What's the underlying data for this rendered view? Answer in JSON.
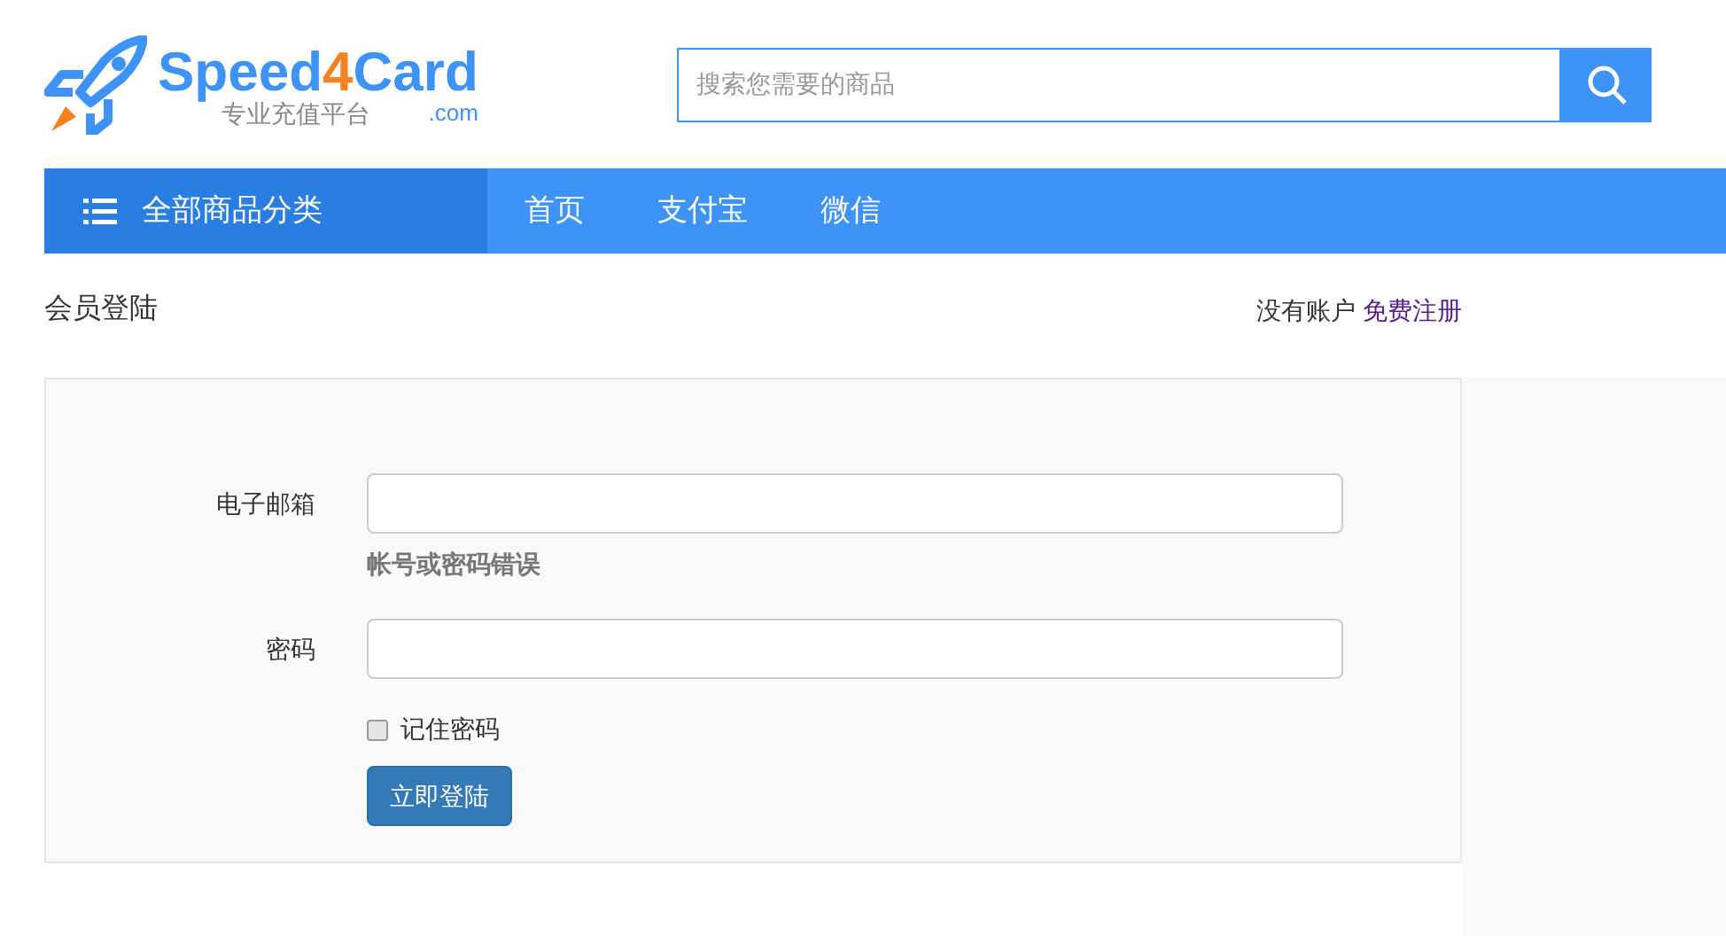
{
  "logo": {
    "name_start": "Speed",
    "name_accent": "4",
    "name_end": "Card",
    "tagline": "专业充值平台",
    "domain": ".com"
  },
  "search": {
    "placeholder": "搜索您需要的商品"
  },
  "nav": {
    "category": "全部商品分类",
    "items": [
      {
        "label": "首页"
      },
      {
        "label": "支付宝"
      },
      {
        "label": "微信"
      }
    ]
  },
  "page_title": "会员登陆",
  "signup": {
    "prompt": "没有账户",
    "link": "免费注册"
  },
  "form": {
    "email_label": "电子邮箱",
    "error": "帐号或密码错误",
    "password_label": "密码",
    "remember": {
      "label": "记住密码",
      "checked": false
    },
    "submit": "立即登陆"
  }
}
